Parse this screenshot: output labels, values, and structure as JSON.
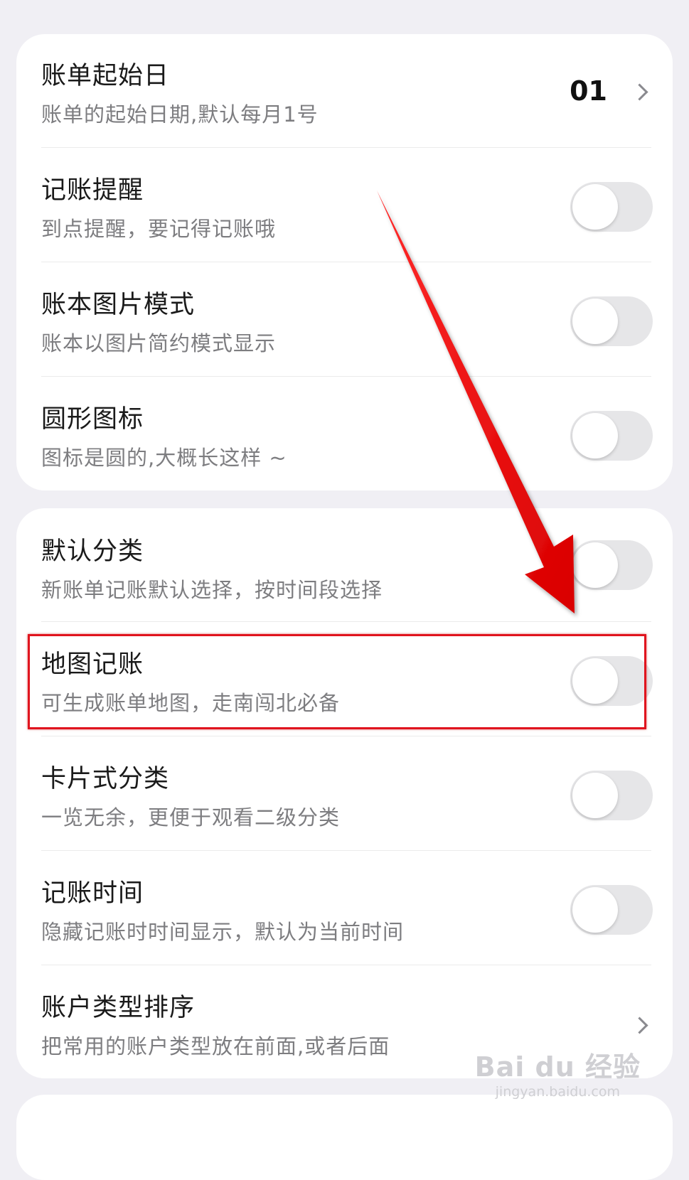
{
  "colors": {
    "page_background": "#f0eff4",
    "card_background": "#ffffff",
    "title_text": "#1a1a1a",
    "subtitle_text": "#7d7d80",
    "toggle_off_track": "#e6e6e8",
    "annotation_red": "#e0141e"
  },
  "group1": {
    "bill_start_day": {
      "title": "账单起始日",
      "subtitle": "账单的起始日期,默认每月1号",
      "value": "01",
      "control": "chevron-right-icon"
    },
    "reminder": {
      "title": "记账提醒",
      "subtitle": "到点提醒，要记得记账哦",
      "enabled": false
    },
    "image_mode": {
      "title": "账本图片模式",
      "subtitle": "账本以图片简约模式显示",
      "enabled": false
    },
    "round_icons": {
      "title": "圆形图标",
      "subtitle": "图标是圆的,大概长这样 ~",
      "enabled": false
    }
  },
  "group2": {
    "default_category": {
      "title": "默认分类",
      "subtitle": "新账单记账默认选择，按时间段选择",
      "enabled": false
    },
    "map_bookkeeping": {
      "title": "地图记账",
      "subtitle": "可生成账单地图，走南闯北必备",
      "enabled": false,
      "highlighted": true
    },
    "card_category": {
      "title": "卡片式分类",
      "subtitle": "一览无余，更便于观看二级分类",
      "enabled": false
    },
    "bookkeeping_time": {
      "title": "记账时间",
      "subtitle": "隐藏记账时时间显示，默认为当前时间",
      "enabled": false
    },
    "account_type_order": {
      "title": "账户类型排序",
      "subtitle": "把常用的账户类型放在前面,或者后面",
      "control": "chevron-right-icon"
    }
  },
  "annotation": {
    "arrow": "red-arrow-icon",
    "target": "map_bookkeeping"
  },
  "watermark": {
    "logo": "Bai du 经验",
    "url": "jingyan.baidu.com"
  }
}
